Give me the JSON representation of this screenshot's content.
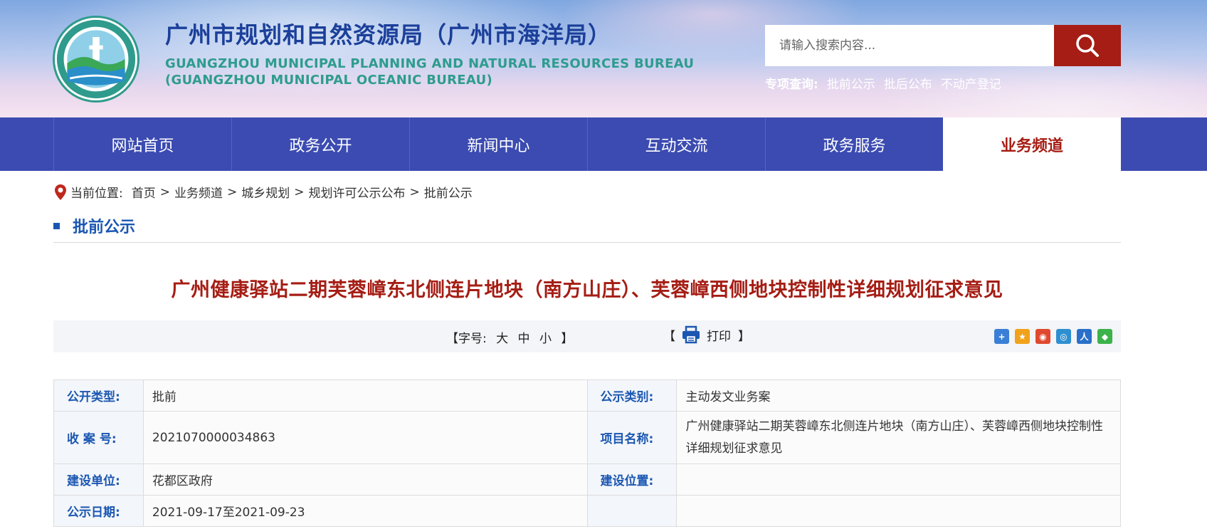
{
  "header": {
    "title": "广州市规划和自然资源局（广州市海洋局）",
    "title_en_line1": "GUANGZHOU MUNICIPAL PLANNING AND NATURAL RESOURCES BUREAU",
    "title_en_line2": "(GUANGZHOU MUNICIPAL OCEANIC BUREAU)",
    "search_placeholder": "请输入搜索内容...",
    "quick_label": "专项查询:",
    "quick_links": [
      "批前公示",
      "批后公布",
      "不动产登记"
    ]
  },
  "nav": {
    "items": [
      "网站首页",
      "政务公开",
      "新闻中心",
      "互动交流",
      "政务服务",
      "业务频道"
    ],
    "active_index": 5
  },
  "breadcrumb": {
    "label": "当前位置:",
    "items": [
      "首页",
      "业务频道",
      "城乡规划",
      "规划许可公示公布",
      "批前公示"
    ],
    "separator": ">"
  },
  "section": {
    "title": "批前公示"
  },
  "article": {
    "title": "广州健康驿站二期芙蓉嶂东北侧连片地块（南方山庄）、芙蓉嶂西侧地块控制性详细规划征求意见"
  },
  "toolbar": {
    "font_open": "【字号:",
    "font_sizes": [
      "大",
      "中",
      "小"
    ],
    "font_close": "】",
    "print_open": "【",
    "print_label": "打印",
    "print_close": "】"
  },
  "info": {
    "rows": [
      [
        {
          "label": "公开类型:",
          "value": "批前"
        },
        {
          "label": "公示类别:",
          "value": "主动发文业务案"
        }
      ],
      [
        {
          "label": "收 案 号:",
          "value": "2021070000034863"
        },
        {
          "label": "项目名称:",
          "value": "广州健康驿站二期芙蓉嶂东北侧连片地块（南方山庄）、芙蓉嶂西侧地块控制性详细规划征求意见"
        }
      ],
      [
        {
          "label": "建设单位:",
          "value": "花都区政府"
        },
        {
          "label": "建设位置:",
          "value": ""
        }
      ],
      [
        {
          "label": "公示日期:",
          "value": "2021-09-17至2021-09-23"
        },
        {
          "label": "",
          "value": ""
        }
      ]
    ]
  },
  "colors": {
    "nav_bg": "#3b4bb1",
    "accent_red": "#a51d14",
    "label_blue": "#1b57b2"
  }
}
